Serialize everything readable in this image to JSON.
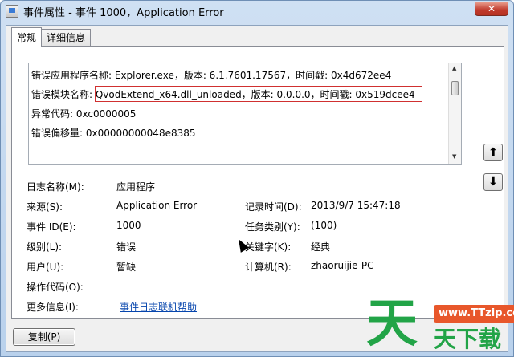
{
  "window": {
    "title": "事件属性 - 事件 1000，Application Error",
    "close_label": "✕"
  },
  "tabs": [
    {
      "label": "常规",
      "active": true
    },
    {
      "label": "详细信息",
      "active": false
    }
  ],
  "description": {
    "lines": [
      "错误应用程序名称: Explorer.exe，版本: 6.1.7601.17567，时间戳: 0x4d672ee4",
      "错误模块名称: QvodExtend_x64.dll_unloaded，版本: 0.0.0.0，时间戳: 0x519dcee4",
      "异常代码: 0xc0000005",
      "错误偏移量: 0x00000000048e8385"
    ]
  },
  "fields": {
    "log_name_label": "日志名称(M):",
    "log_name_value": "应用程序",
    "source_label": "来源(S):",
    "source_value": "Application Error",
    "logged_label": "记录时间(D):",
    "logged_value": "2013/9/7 15:47:18",
    "event_id_label": "事件 ID(E):",
    "event_id_value": "1000",
    "task_category_label": "任务类别(Y):",
    "task_category_value": "(100)",
    "level_label": "级别(L):",
    "level_value": "错误",
    "keywords_label": "关键字(K):",
    "keywords_value": "经典",
    "user_label": "用户(U):",
    "user_value": "暂缺",
    "computer_label": "计算机(R):",
    "computer_value": "zhaoruijie-PC",
    "opcode_label": "操作代码(O):",
    "more_info_label": "更多信息(I):",
    "more_info_link": "事件日志联机帮助"
  },
  "buttons": {
    "copy": "复制(P)",
    "up_arrow": "⬆",
    "down_arrow": "⬇"
  },
  "watermark": {
    "big_char": "天",
    "url": "www.TTzip.com",
    "sub": "天下载"
  },
  "colors": {
    "link": "#0645ad",
    "highlight_border": "#d03030",
    "watermark_green": "#22a447",
    "watermark_orange": "#e8572b"
  }
}
